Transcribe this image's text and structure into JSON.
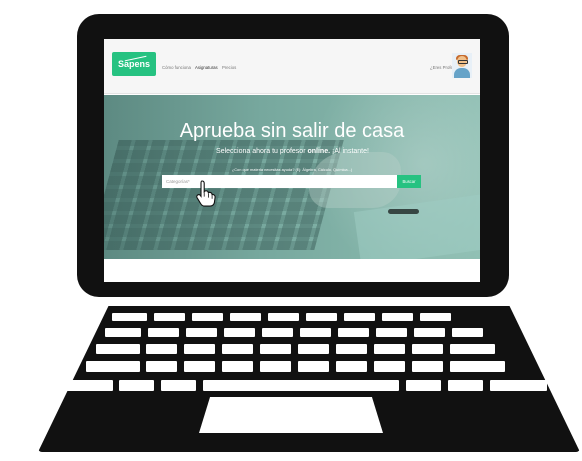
{
  "nav": {
    "logo_text": "Sapens",
    "links": [
      "Cómo funciona",
      "Asignaturas",
      "Precios"
    ],
    "login": "¿Eres Profe?"
  },
  "hero": {
    "title": "Aprueba sin salir de casa",
    "subtitle_before": "Selecciona ahora tu profesor ",
    "subtitle_bold": "online.",
    "subtitle_after": " ¡Al instante!",
    "question": "¿Con qué materia necesitas ayuda? (Ej: Álgebra, Cálculo, Química...)",
    "search_placeholder": "Categorías*",
    "search_button": "Buscar"
  },
  "icons": {
    "logo": "sapens-logo",
    "avatar": "teacher-avatar",
    "cursor": "hand-pointer-icon"
  },
  "colors": {
    "accent": "#26c281",
    "hero_overlay": "#77a89e",
    "laptop": "#111111"
  }
}
